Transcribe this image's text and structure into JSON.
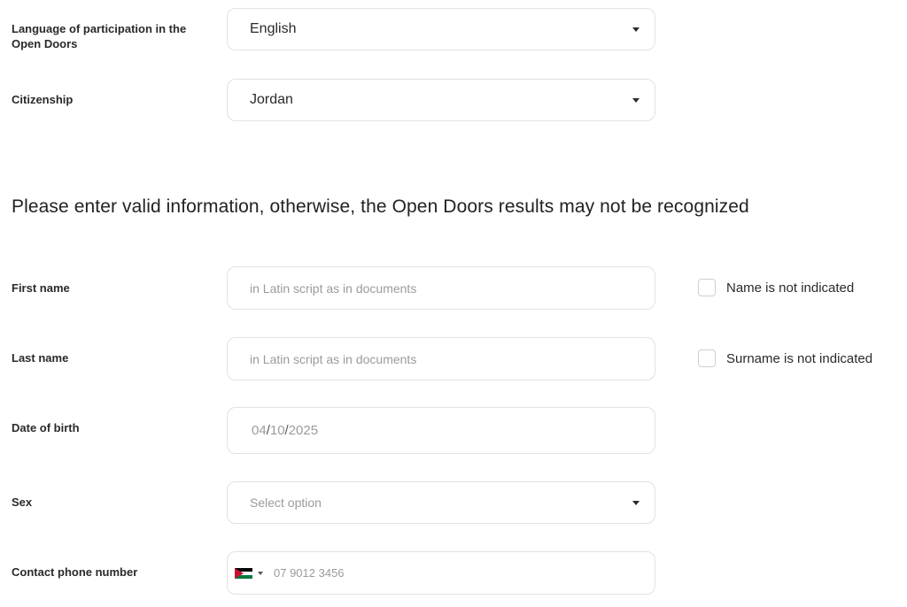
{
  "form": {
    "language": {
      "label": "Language of participation in the Open Doors",
      "value": "English"
    },
    "citizenship": {
      "label": "Citizenship",
      "value": "Jordan"
    },
    "notice": "Please enter valid information, otherwise, the Open Doors results may not be recognized",
    "first_name": {
      "label": "First name",
      "placeholder": "in Latin script as in documents",
      "checkbox_label": "Name is not indicated"
    },
    "last_name": {
      "label": "Last name",
      "placeholder": "in Latin script as in documents",
      "checkbox_label": "Surname is not indicated"
    },
    "date_of_birth": {
      "label": "Date of birth",
      "day": "04",
      "month": "10",
      "year": "2025",
      "separator": "/"
    },
    "sex": {
      "label": "Sex",
      "placeholder": "Select option"
    },
    "phone": {
      "label": "Contact phone number",
      "placeholder": "07 9012 3456",
      "country_icon": "jordan-flag-icon",
      "flag_colors": [
        "#000000",
        "#ffffff",
        "#007a3d",
        "#c8102e"
      ]
    }
  }
}
